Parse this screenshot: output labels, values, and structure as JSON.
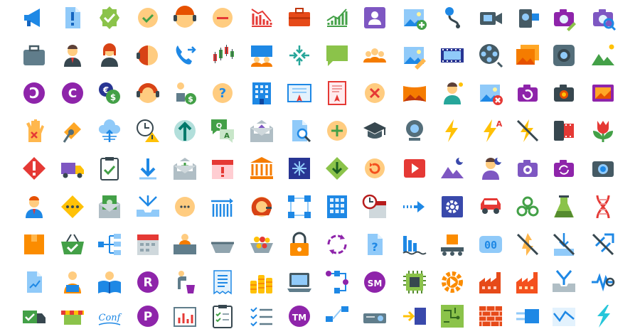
{
  "icons": [
    [
      "megaphone-icon",
      "important-document-icon",
      "approval-badge-icon",
      "ok-face-icon",
      "online-support-icon",
      "neutral-face-icon",
      "bearish-chart-icon",
      "briefcase-icon",
      "bullish-chart-icon",
      "portrait-mode-icon",
      "add-image-icon",
      "webcam-link-icon",
      "video-camera-icon",
      "camcorder-icon",
      "edit-camera-icon",
      "search-camera-icon"
    ],
    [
      "suitcase-icon",
      "businessman-icon",
      "businesswoman-icon",
      "customer-support-icon",
      "call-transfer-icon",
      "candlestick-chart-icon",
      "meeting-icon",
      "collapse-icon",
      "chat-bubble-icon",
      "conference-call-icon",
      "edit-image-icon",
      "film-strip-icon",
      "film-reel-icon",
      "gallery-icon",
      "camera-lens-icon",
      "landscape-icon"
    ],
    [
      "copyleft-icon",
      "copyright-icon",
      "currency-exchange-icon",
      "assistant-icon",
      "cash-in-hand-icon",
      "faq-face-icon",
      "office-building-icon",
      "diploma-icon",
      "certificate-icon",
      "cancel-face-icon",
      "panorama-icon",
      "manager-icon",
      "broken-image-icon",
      "rotate-camera-icon",
      "self-timer-camera-icon",
      "photo-reel-icon"
    ],
    [
      "stop-hand-icon",
      "key-card-icon",
      "cloud-upload-icon",
      "expired-timer-icon",
      "up-arrow-icon",
      "faq-chat-icon",
      "open-mail-icon",
      "search-document-icon",
      "add-face-icon",
      "graduation-cap-icon",
      "webcam-icon",
      "flash-on-icon",
      "flash-auto-icon",
      "flash-off-icon",
      "film-cartridge-icon",
      "flower-icon"
    ],
    [
      "warning-diamond-icon",
      "shipping-truck-icon",
      "checked-clipboard-icon",
      "download-arrow-icon",
      "add-mail-icon",
      "calendar-alert-icon",
      "museum-icon",
      "sparkle-icon",
      "down-left-icon",
      "refresh-face-icon",
      "video-play-icon",
      "night-landscape-icon",
      "night-portrait-icon",
      "camera-icon",
      "switch-camera-icon",
      "photo-camera-icon"
    ],
    [
      "employee-icon",
      "ellipsis-diamond-icon",
      "money-mail-icon",
      "inbox-download-icon",
      "blank-face-icon",
      "data-grid-icon",
      "headset-user-icon",
      "workflow-icon",
      "city-building-icon",
      "schedule-icon",
      "next-arrow-icon",
      "settings-icon",
      "car-icon",
      "biohazard-icon",
      "chemistry-icon",
      "dna-icon"
    ],
    [
      "package-icon",
      "shopping-basket-icon",
      "org-chart-icon",
      "planner-icon",
      "user-desk-icon",
      "empty-tray-icon",
      "full-tray-icon",
      "padlock-icon",
      "sync-icon",
      "help-document-icon",
      "factory-water-icon",
      "conveyor-box-icon",
      "numeric-display-icon",
      "no-light-icon",
      "no-import-icon",
      "no-link-icon"
    ],
    [
      "stock-report-icon",
      "reading-user-icon",
      "reading-book-icon",
      "registered-icon",
      "trash-bin-icon",
      "receipt-icon",
      "coin-stacks-icon",
      "laptop-icon",
      "process-icon",
      "service-mark-icon",
      "chip-icon",
      "gear-icon",
      "factory-icon",
      "brick-factory-icon",
      "inbox-merge-icon",
      "pulse-icon"
    ],
    [
      "delivery-check-icon",
      "market-stall-icon",
      "signature-icon",
      "premium-icon",
      "bar-board-icon",
      "checklist-clipboard-icon",
      "task-list-icon",
      "trademark-icon",
      "network-icon",
      "projector-icon",
      "server-arrow-icon",
      "circuit-board-icon",
      "brick-wall-icon",
      "power-plug-icon",
      "line-graph-icon",
      "lightning-icon"
    ]
  ],
  "badge_text": {
    "copyleft": "C",
    "copyright": "C",
    "registered": "R",
    "service_mark": "SM",
    "trademark": "TM",
    "premium": "P",
    "faq_q": "Q",
    "faq_a": "A",
    "help": "?",
    "faq": "?",
    "flash_auto": "A",
    "numeric_display": "00",
    "signature": "Conf"
  },
  "colors": {
    "primary_blue": "#1E88E5",
    "light_blue": "#90CAF9",
    "purple": "#8E24AA",
    "purple_light": "#7E57C2",
    "orange": "#FB8C00",
    "amber": "#FFC107",
    "green": "#43A047",
    "light_green": "#8BC34A",
    "red": "#E53935",
    "skin": "#FFCC80",
    "grey": "#607D8B",
    "brown": "#795548"
  }
}
